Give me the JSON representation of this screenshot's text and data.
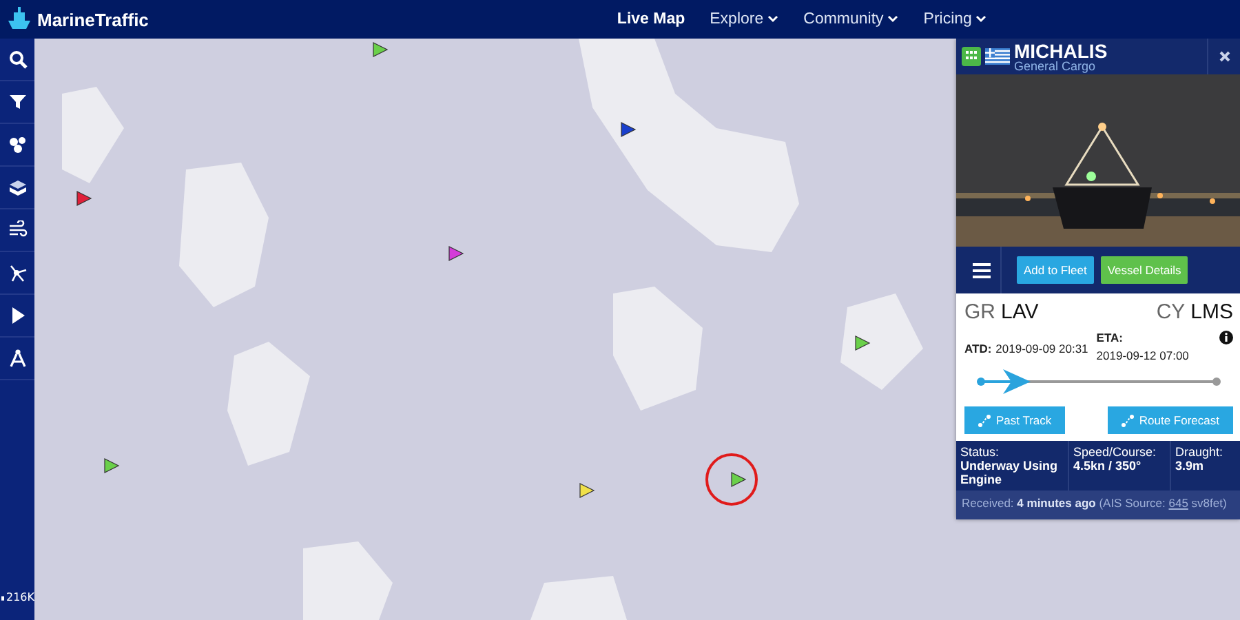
{
  "header": {
    "logo": "MarineTraffic",
    "nav": [
      {
        "label": "Live Map",
        "selected": true,
        "dropdown": false
      },
      {
        "label": "Explore",
        "selected": false,
        "dropdown": true
      },
      {
        "label": "Community",
        "selected": false,
        "dropdown": true
      },
      {
        "label": "Pricing",
        "selected": false,
        "dropdown": true
      }
    ]
  },
  "toolbar": {
    "tools": [
      {
        "kind": "search"
      },
      {
        "kind": "filter"
      },
      {
        "kind": "cluster"
      },
      {
        "kind": "layers"
      },
      {
        "kind": "wind"
      },
      {
        "kind": "network"
      },
      {
        "kind": "play"
      },
      {
        "kind": "compass"
      }
    ],
    "count": "216K"
  },
  "vessel": {
    "name": "MICHALIS",
    "type": "General Cargo",
    "actions": [
      {
        "label": "Add to Fleet",
        "kind": "fleet"
      },
      {
        "label": "Vessel Details",
        "kind": "details"
      }
    ],
    "departure": {
      "country": "GR",
      "port": "LAV"
    },
    "arrival": {
      "country": "CY",
      "port": "LMS"
    },
    "atd_label": "ATD:",
    "atd": "2019-09-09 20:31",
    "eta_label": "ETA:",
    "eta": "2019-09-12 07:00",
    "progress": {
      "level": 0.15
    },
    "track_buttons": [
      "Past Track",
      "Route Forecast"
    ],
    "stats": [
      {
        "label": "Status:",
        "value": "Underway Using Engine"
      },
      {
        "label": "Speed/Course:",
        "value": "4.5kn / 350°"
      },
      {
        "label": "Draught:",
        "value": "3.9m"
      }
    ],
    "received": {
      "text": "Received: **4 minutes ago** (AIS Source: ",
      "link": "645",
      "after": "sv8fet)"
    }
  }
}
